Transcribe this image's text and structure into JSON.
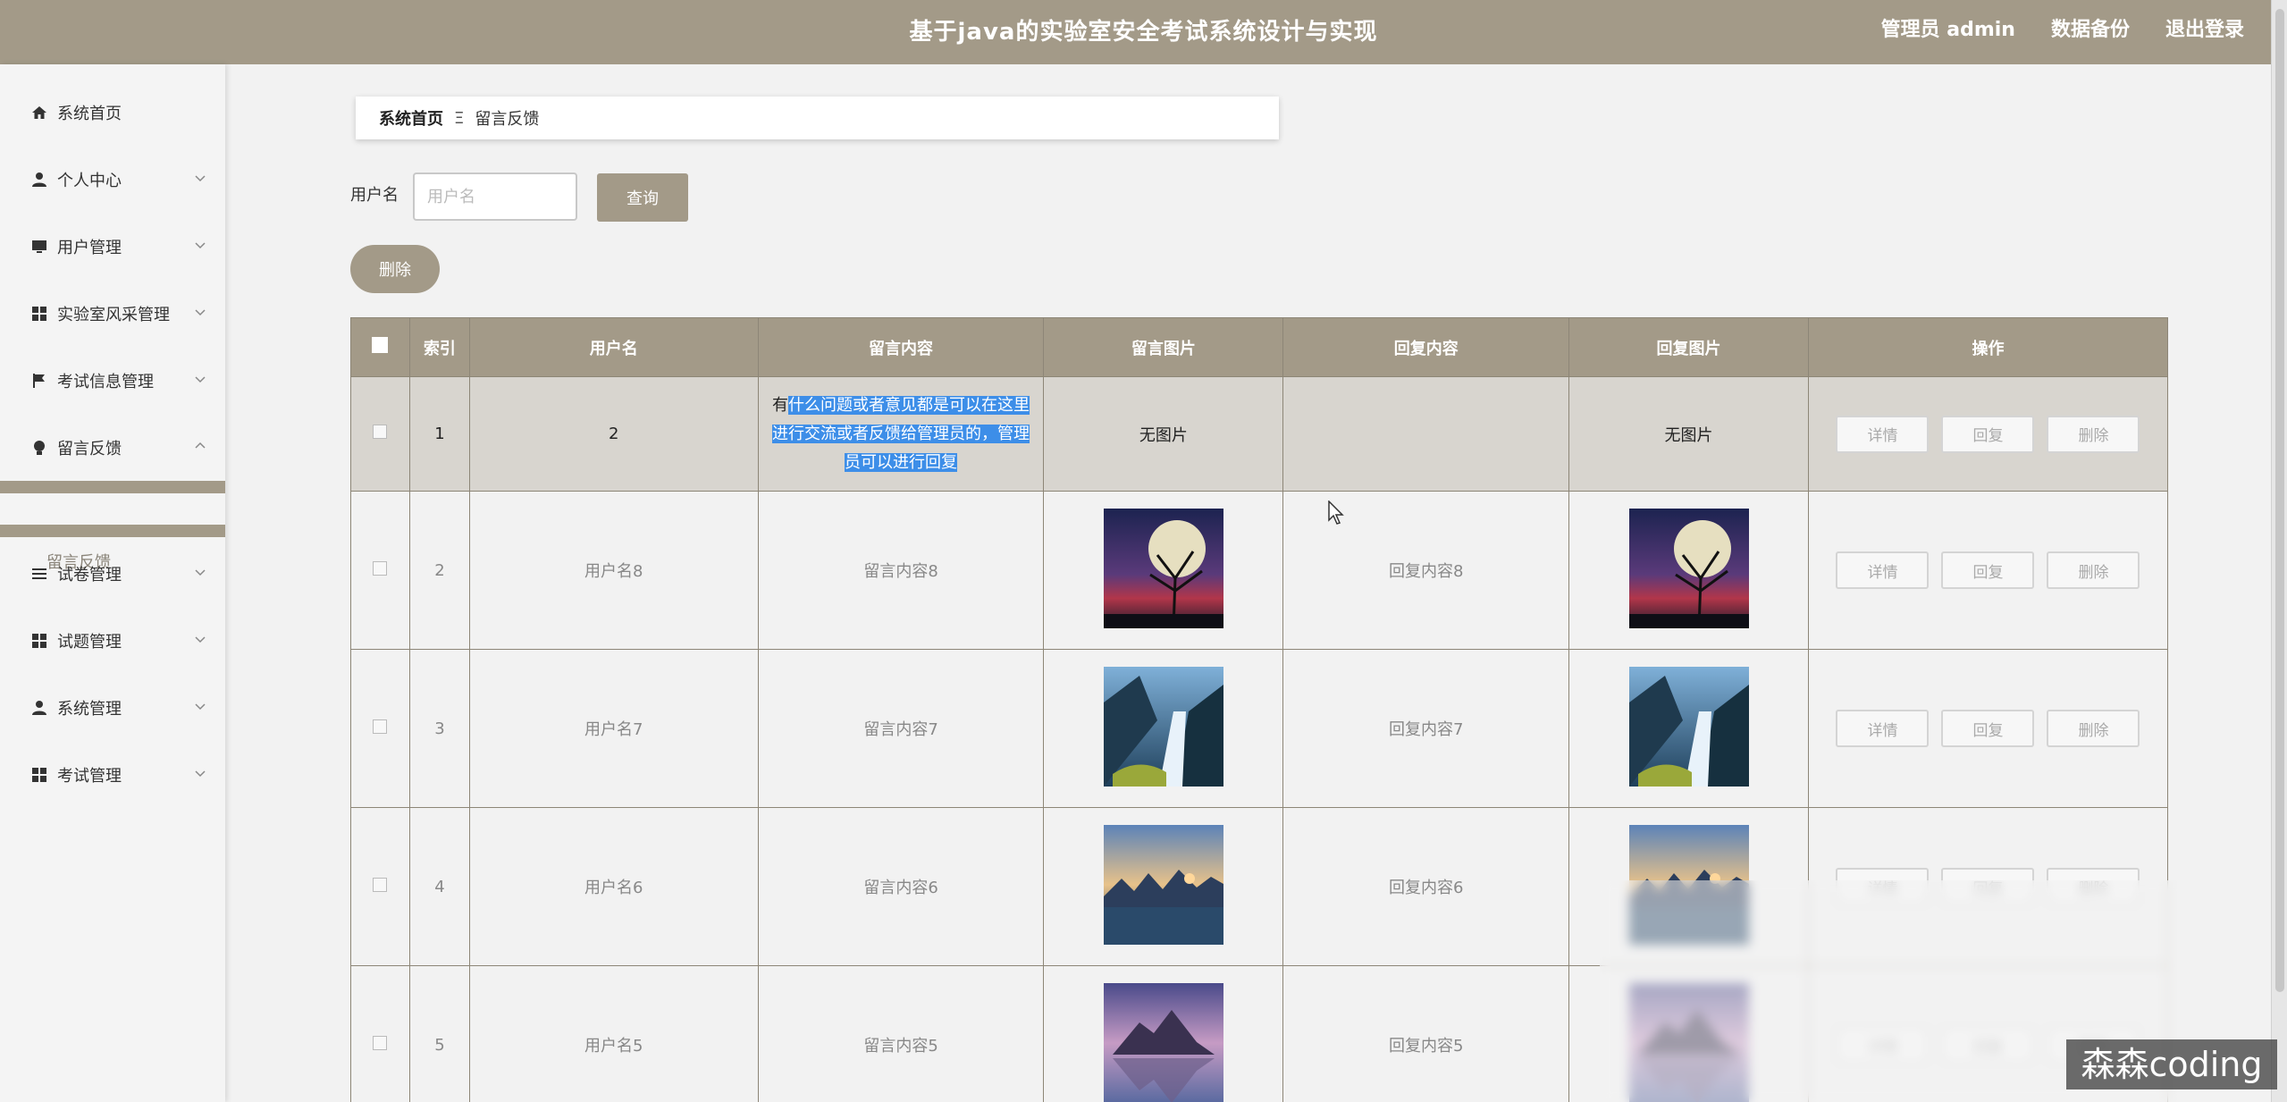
{
  "header": {
    "title": "基于java的实验室安全考试系统设计与实现",
    "admin_label": "管理员 admin",
    "backup_label": "数据备份",
    "logout_label": "退出登录"
  },
  "sidebar": {
    "items": [
      {
        "label": "系统首页",
        "icon": "home-icon"
      },
      {
        "label": "个人中心",
        "icon": "user-icon"
      },
      {
        "label": "用户管理",
        "icon": "monitor-icon"
      },
      {
        "label": "实验室风采管理",
        "icon": "grid-icon"
      },
      {
        "label": "考试信息管理",
        "icon": "flag-icon"
      },
      {
        "label": "留言反馈",
        "icon": "bulb-icon"
      },
      {
        "label": "试卷管理",
        "icon": "list-icon"
      },
      {
        "label": "试题管理",
        "icon": "grid-icon"
      },
      {
        "label": "系统管理",
        "icon": "user-icon"
      },
      {
        "label": "考试管理",
        "icon": "grid-icon"
      }
    ],
    "active_sub": "留言反馈"
  },
  "breadcrumb": {
    "home": "系统首页",
    "separator": "Ξ",
    "current": "留言反馈"
  },
  "search": {
    "label": "用户名",
    "placeholder": "用户名",
    "value": "",
    "query_button": "查询"
  },
  "toolbar": {
    "delete_button": "删除"
  },
  "table": {
    "headers": [
      "索引",
      "用户名",
      "留言内容",
      "留言图片",
      "回复内容",
      "回复图片",
      "操作"
    ],
    "rows": [
      {
        "index": "1",
        "username": "2",
        "content_first": "有",
        "content_highlight": "什么问题或者意见都是可以在这里进行交流或者反馈给管理员的，管理员可以进行回复",
        "image": "无图片",
        "reply": "",
        "reply_image": "无图片"
      },
      {
        "index": "2",
        "username": "用户名8",
        "content": "留言内容8",
        "image_type": "moon-tree",
        "reply": "回复内容8",
        "reply_image_type": "moon-tree"
      },
      {
        "index": "3",
        "username": "用户名7",
        "content": "留言内容7",
        "image_type": "waterfall",
        "reply": "回复内容7",
        "reply_image_type": "waterfall"
      },
      {
        "index": "4",
        "username": "用户名6",
        "content": "留言内容6",
        "image_type": "lake-sunset",
        "reply": "回复内容6",
        "reply_image_type": "lake-sunset"
      },
      {
        "index": "5",
        "username": "用户名5",
        "content": "留言内容5",
        "image_type": "mountain-reflection",
        "reply": "回复内容5",
        "reply_image_type": "mountain-reflection"
      }
    ],
    "ops": {
      "detail": "详情",
      "reply": "回复",
      "delete": "删除"
    }
  },
  "watermark": "森森coding",
  "colors": {
    "accent": "#a39a88",
    "highlight": "#3d8ee8"
  }
}
